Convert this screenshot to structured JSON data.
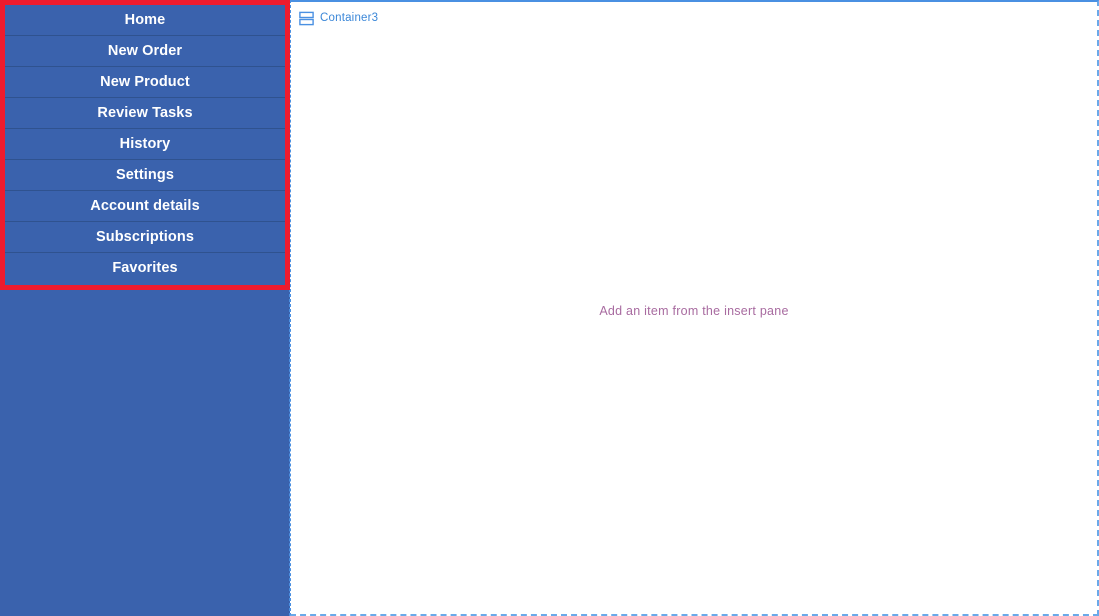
{
  "sidebar": {
    "name": "navigation-menu",
    "background_color": "#3a62ad",
    "separator_color": "#2f528f",
    "text_color": "#ffffff",
    "items": [
      {
        "label": "Home"
      },
      {
        "label": "New Order"
      },
      {
        "label": "New Product"
      },
      {
        "label": "Review Tasks"
      },
      {
        "label": "History"
      },
      {
        "label": "Settings"
      },
      {
        "label": "Account details"
      },
      {
        "label": "Subscriptions"
      },
      {
        "label": "Favorites"
      }
    ]
  },
  "highlight": {
    "color": "#ee1b2e",
    "border_width": 5
  },
  "content": {
    "container": {
      "icon": "stacked-rows-icon",
      "label": "Container3",
      "label_color": "#3b87d8"
    },
    "empty_state": {
      "message": "Add an item from the insert pane",
      "color": "#a86ba0"
    },
    "border_color": "#4a90e2"
  }
}
